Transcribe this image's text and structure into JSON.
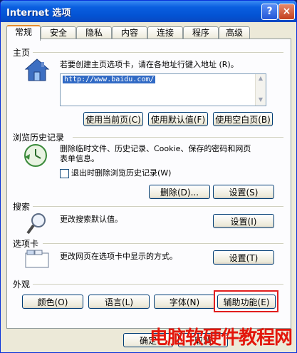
{
  "window": {
    "title": "Internet 选项",
    "help_label": "?",
    "close_label": "×"
  },
  "tabs": [
    {
      "label": "常规",
      "active": true
    },
    {
      "label": "安全"
    },
    {
      "label": "隐私"
    },
    {
      "label": "内容"
    },
    {
      "label": "连接"
    },
    {
      "label": "程序"
    },
    {
      "label": "高级"
    }
  ],
  "home": {
    "heading": "主页",
    "desc": "若要创建主页选项卡，请在各地址行键入地址 (R)。",
    "url": "http://www.baidu.com/",
    "btn_current": "使用当前页(C)",
    "btn_default": "使用默认值(F)",
    "btn_blank": "使用空白页(B)"
  },
  "history": {
    "heading": "浏览历史记录",
    "desc1": "删除临时文件、历史记录、Cookie、保存的密码和网页",
    "desc2": "表单信息。",
    "checkbox_label": "退出时删除浏览历史记录(W)",
    "btn_delete": "删除(D)...",
    "btn_settings": "设置(S)"
  },
  "search": {
    "heading": "搜索",
    "desc": "更改搜索默认值。",
    "btn_settings": "设置(I)"
  },
  "tabs_section": {
    "heading": "选项卡",
    "desc": "更改网页在选项卡中显示的方式。",
    "btn_settings": "设置(T)"
  },
  "appearance": {
    "heading": "外观",
    "btn_colors": "颜色(O)",
    "btn_languages": "语言(L)",
    "btn_fonts": "字体(N)",
    "btn_accessibility": "辅助功能(E)"
  },
  "footer": {
    "ok": "确定",
    "cancel": "取消"
  },
  "watermark": "电脑软硬件教程网",
  "colors": {
    "highlight": "#e11e1e",
    "title_bar": "#0a5fe0"
  }
}
